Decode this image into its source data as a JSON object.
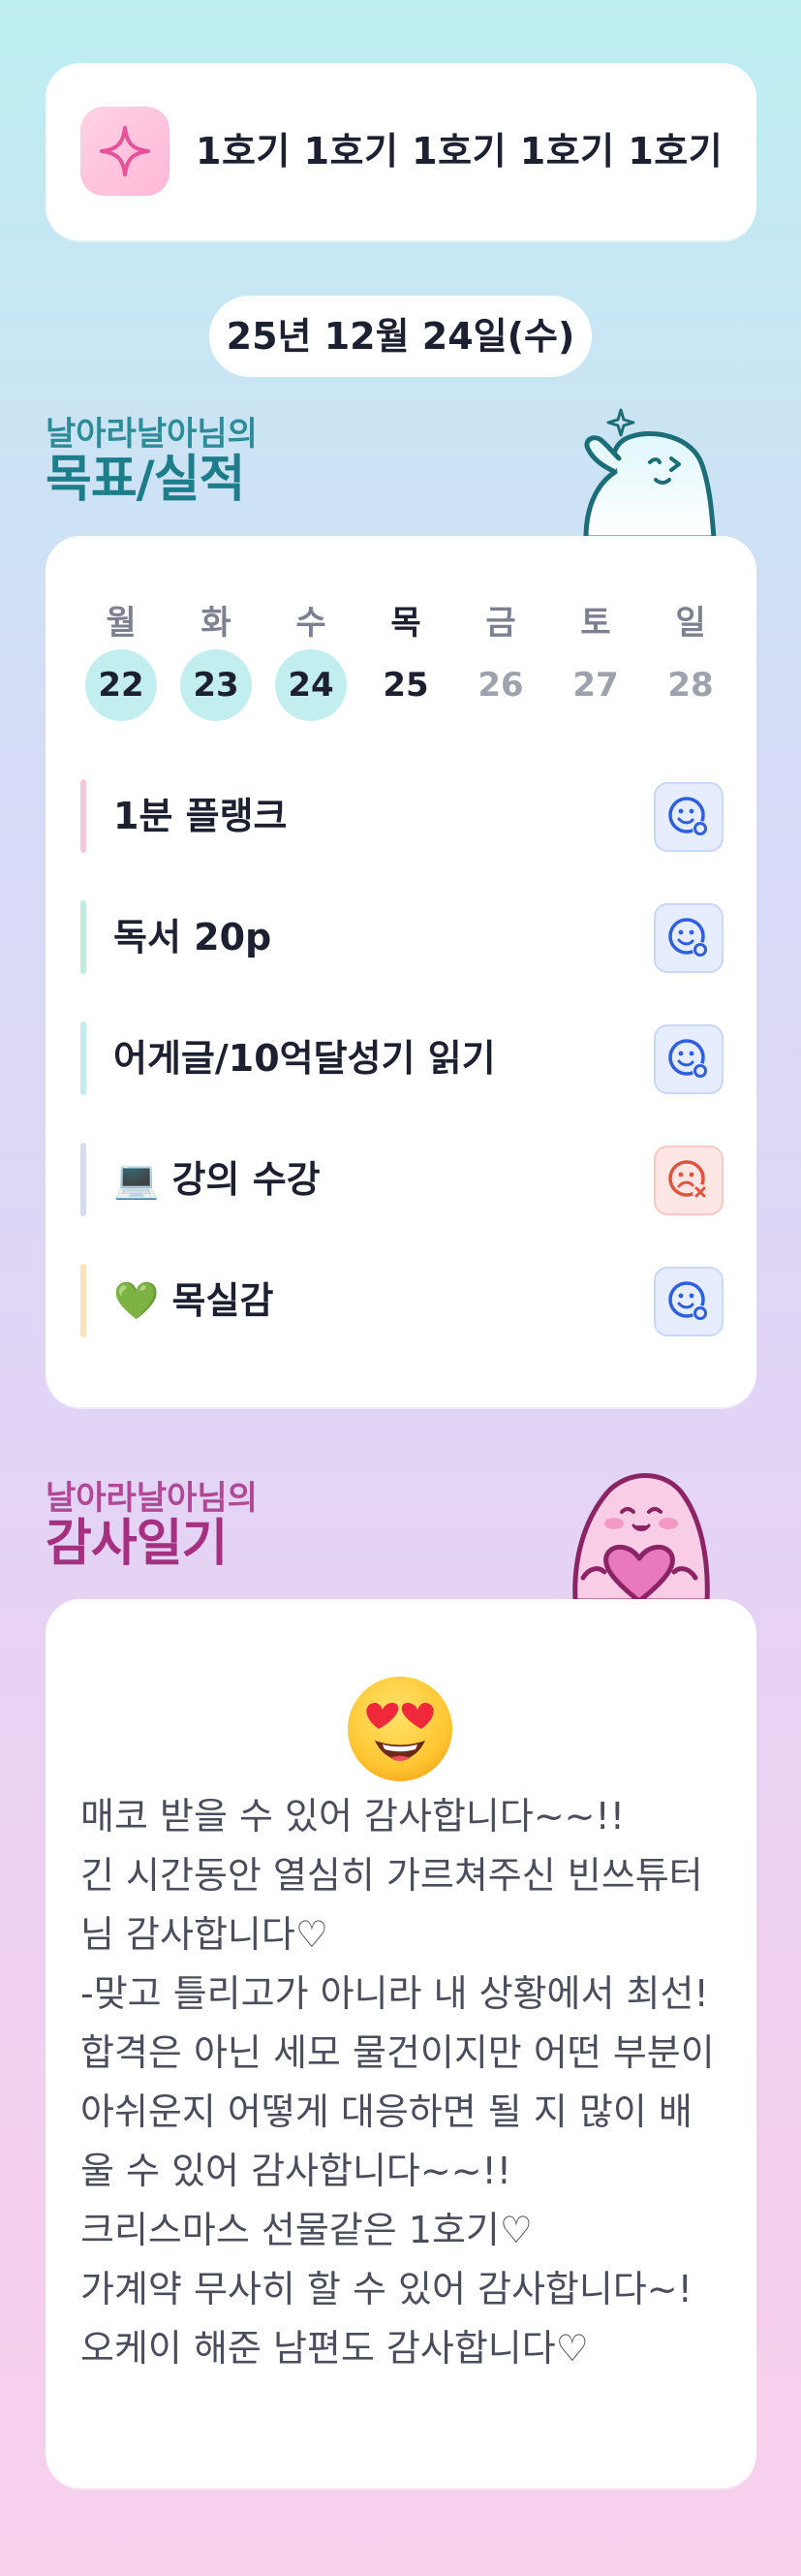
{
  "header": {
    "title": "1호기 1호기 1호기 1호기 1호기",
    "icon": "sparkle-icon"
  },
  "date": "25년 12월 24일(수)",
  "goals_section": {
    "subtitle": "날아라날아님의",
    "title": "목표/실적"
  },
  "week": [
    {
      "day": "월",
      "date": "22",
      "state": "done"
    },
    {
      "day": "화",
      "date": "23",
      "state": "done"
    },
    {
      "day": "수",
      "date": "24",
      "state": "done"
    },
    {
      "day": "목",
      "date": "25",
      "state": "today"
    },
    {
      "day": "금",
      "date": "26",
      "state": "future"
    },
    {
      "day": "토",
      "date": "27",
      "state": "future"
    },
    {
      "day": "일",
      "date": "28",
      "state": "future"
    }
  ],
  "goals": [
    {
      "label": "1분 플랭크",
      "status": "success",
      "bar_color": "#f7c6dc"
    },
    {
      "label": "독서 20p",
      "status": "success",
      "bar_color": "#bdeedd"
    },
    {
      "label": "어게글/10억달성기 읽기",
      "status": "success",
      "bar_color": "#bfeef0"
    },
    {
      "label": "💻 강의 수강",
      "status": "fail",
      "bar_color": "#d5dcf2"
    },
    {
      "label": "💚 목실감",
      "status": "success",
      "bar_color": "#f9e4b8"
    }
  ],
  "gratitude_section": {
    "subtitle": "날아라날아님의",
    "title": "감사일기"
  },
  "gratitude": {
    "emoji": "heart-eyes-emoji",
    "text": "매코 받을 수 있어 감사합니다~~!!\n긴 시간동안 열심히 가르쳐주신 빈쓰튜터님 감사합니다♡\n-맞고 틀리고가 아니라 내 상황에서 최선!\n합격은 아닌 세모 물건이지만 어떤 부분이 아쉬운지 어떻게 대응하면 될 지 많이 배울 수 있어 감사합니다~~!!\n크리스마스 선물같은 1호기♡\n가계약 무사히 할 수 있어 감사합니다~!\n오케이 해준 남편도 감사합니다♡"
  },
  "colors": {
    "accent_teal": "#1e7d8a",
    "accent_magenta": "#a5307f",
    "success_blue": "#2f5fe0",
    "fail_red": "#e0533d",
    "done_circle": "#c3eef0"
  }
}
